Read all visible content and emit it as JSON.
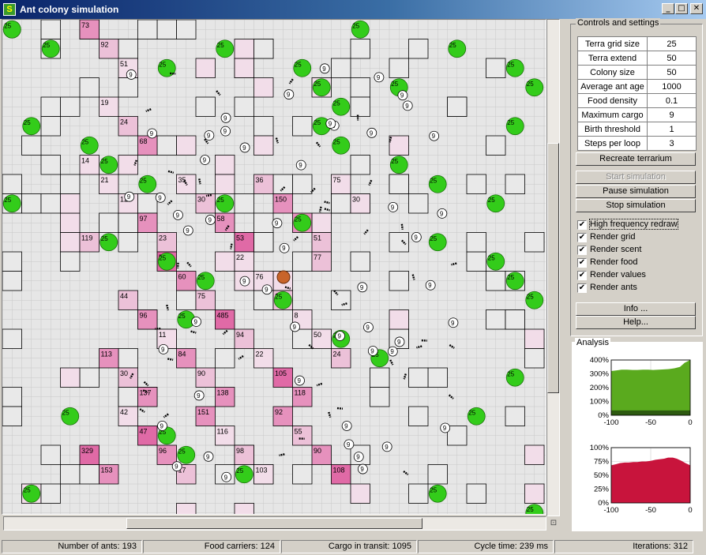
{
  "window": {
    "title": "Ant colony simulation",
    "app_icon": "S",
    "minimize_glyph": "_",
    "maximize_glyph": "□",
    "close_glyph": "✕"
  },
  "controls": {
    "group_title": "Controls and settings",
    "settings": [
      {
        "label": "Terra grid size",
        "value": "25"
      },
      {
        "label": "Terra extend",
        "value": "50"
      },
      {
        "label": "Colony size",
        "value": "50"
      },
      {
        "label": "Average ant age",
        "value": "1000"
      },
      {
        "label": "Food density",
        "value": "0.1"
      },
      {
        "label": "Maximum cargo",
        "value": "9"
      },
      {
        "label": "Birth threshold",
        "value": "1"
      },
      {
        "label": "Steps per loop",
        "value": "3"
      }
    ],
    "recreate_button": "Recreate terrarium",
    "start_button": "Start simulation",
    "pause_button": "Pause simulation",
    "stop_button": "Stop simulation",
    "checkboxes": [
      {
        "label": "High frequency redraw",
        "checked": true
      },
      {
        "label": "Render grid",
        "checked": true
      },
      {
        "label": "Render scent",
        "checked": true
      },
      {
        "label": "Render food",
        "checked": true
      },
      {
        "label": "Render values",
        "checked": true
      },
      {
        "label": "Render ants",
        "checked": true
      }
    ],
    "check_glyph": "✔",
    "info_button": "Info ...",
    "help_button": "Help..."
  },
  "status": {
    "ants": "Number of ants: 193",
    "carriers": "Food carriers: 124",
    "cargo": "Cargo in transit: 1095",
    "cycle": "Cycle time: 239 ms",
    "iterations": "Iterations: 312"
  },
  "terrarium": {
    "food_color": "#33cc1a",
    "food_value": "25",
    "nest_color": "#c8642a",
    "ant_marker": "9",
    "scent_colors": [
      "#f2dde9",
      "#ecc1d8",
      "#e691bd",
      "#e06aa6"
    ],
    "visited_color": "#d6d6d6",
    "food_cells": [
      [
        0,
        0
      ],
      [
        2,
        0
      ],
      [
        8,
        0
      ],
      [
        16,
        0
      ],
      [
        17,
        0
      ],
      [
        18,
        0
      ],
      [
        23,
        0
      ],
      [
        26,
        0
      ],
      [
        27,
        0
      ],
      [
        0,
        1
      ],
      [
        1,
        1
      ],
      [
        4,
        1
      ],
      [
        5,
        1
      ],
      [
        7,
        1
      ],
      [
        11,
        1
      ],
      [
        16,
        1
      ],
      [
        17,
        1
      ],
      [
        20,
        1
      ],
      [
        22,
        1
      ],
      [
        25,
        1
      ],
      [
        26,
        1
      ],
      [
        5,
        2
      ],
      [
        8,
        2
      ],
      [
        10,
        2
      ],
      [
        14,
        2
      ],
      [
        15,
        2
      ],
      [
        22,
        2
      ],
      [
        25,
        2
      ],
      [
        26,
        2
      ],
      [
        27,
        2
      ],
      [
        9,
        3
      ],
      [
        17,
        3
      ],
      [
        19,
        3
      ],
      [
        26,
        3
      ],
      [
        1,
        4
      ],
      [
        3,
        4
      ],
      [
        8,
        4
      ],
      [
        9,
        4
      ],
      [
        12,
        4
      ],
      [
        22,
        4
      ],
      [
        24,
        4
      ],
      [
        0,
        5
      ],
      [
        11,
        5
      ],
      [
        15,
        5
      ],
      [
        20,
        5
      ],
      [
        27,
        5
      ]
    ],
    "scent_cells": [
      [
        4,
        0,
        3,
        "73"
      ],
      [
        5,
        0,
        2,
        "92"
      ],
      [
        6,
        0,
        1,
        "51"
      ],
      [
        4,
        1,
        1,
        "14"
      ],
      [
        5,
        1,
        1,
        "19"
      ],
      [
        6,
        1,
        2,
        "24"
      ],
      [
        7,
        1,
        3,
        "68"
      ],
      [
        4,
        2,
        2,
        "119"
      ],
      [
        5,
        2,
        1,
        "21"
      ],
      [
        6,
        2,
        1,
        "12"
      ],
      [
        7,
        2,
        3,
        "97"
      ],
      [
        8,
        2,
        2,
        "23"
      ],
      [
        9,
        2,
        1,
        "35"
      ],
      [
        10,
        2,
        2,
        "30"
      ],
      [
        11,
        2,
        3,
        "58"
      ],
      [
        12,
        2,
        4,
        "53"
      ],
      [
        13,
        2,
        2,
        "36"
      ],
      [
        14,
        2,
        3,
        "150"
      ],
      [
        15,
        2,
        3,
        "44"
      ],
      [
        16,
        2,
        2,
        "51"
      ],
      [
        17,
        2,
        1,
        "75"
      ],
      [
        18,
        2,
        1,
        "30"
      ],
      [
        6,
        3,
        2,
        "44"
      ],
      [
        7,
        3,
        3,
        "96"
      ],
      [
        8,
        3,
        4,
        "579"
      ],
      [
        9,
        3,
        3,
        "60"
      ],
      [
        10,
        3,
        2,
        "75"
      ],
      [
        11,
        3,
        4,
        "485"
      ],
      [
        12,
        3,
        1,
        "22"
      ],
      [
        13,
        3,
        1,
        "76"
      ],
      [
        14,
        3,
        2,
        "17"
      ],
      [
        15,
        3,
        1,
        "8"
      ],
      [
        16,
        3,
        2,
        "77"
      ],
      [
        5,
        4,
        3,
        "113"
      ],
      [
        6,
        4,
        2,
        "30"
      ],
      [
        7,
        4,
        3,
        "137"
      ],
      [
        8,
        4,
        1,
        "11"
      ],
      [
        9,
        4,
        3,
        "84"
      ],
      [
        10,
        4,
        2,
        "90"
      ],
      [
        11,
        4,
        3,
        "138"
      ],
      [
        12,
        4,
        2,
        "94"
      ],
      [
        13,
        4,
        1,
        "22"
      ],
      [
        14,
        4,
        4,
        "105"
      ],
      [
        15,
        4,
        3,
        "118"
      ],
      [
        16,
        4,
        1,
        "50"
      ],
      [
        17,
        4,
        2,
        "24"
      ],
      [
        4,
        5,
        4,
        "329"
      ],
      [
        5,
        5,
        3,
        "153"
      ],
      [
        6,
        5,
        1,
        "42"
      ],
      [
        7,
        5,
        4,
        "47"
      ],
      [
        8,
        5,
        3,
        "96"
      ],
      [
        9,
        5,
        2,
        "17"
      ],
      [
        10,
        5,
        3,
        "151"
      ],
      [
        11,
        5,
        1,
        "116"
      ],
      [
        12,
        5,
        2,
        "98"
      ],
      [
        13,
        5,
        1,
        "103"
      ],
      [
        14,
        5,
        3,
        "92"
      ],
      [
        15,
        5,
        2,
        "55"
      ],
      [
        16,
        5,
        3,
        "90"
      ],
      [
        17,
        5,
        4,
        "108"
      ]
    ]
  },
  "analysis": {
    "group_title": "Analysis"
  },
  "chart_data": [
    {
      "type": "area",
      "series": [
        {
          "values": [
            320,
            325,
            330,
            330,
            328,
            328,
            330,
            330,
            328,
            330,
            332,
            334,
            340,
            350,
            380,
            400
          ]
        }
      ],
      "x": [
        -100,
        -93,
        -87,
        -80,
        -73,
        -67,
        -60,
        -53,
        -47,
        -40,
        -33,
        -27,
        -20,
        -13,
        -7,
        0
      ],
      "dark_base": 35,
      "ylim": [
        0,
        400
      ],
      "yticks": [
        "400%",
        "300%",
        "200%",
        "100%",
        "0%"
      ],
      "xticks": [
        "-100",
        "-50",
        "0"
      ],
      "fill_color": "#5aaa1e",
      "base_color": "#2d5a10",
      "grid": true
    },
    {
      "type": "area",
      "series": [
        {
          "values": [
            68,
            70,
            72,
            73,
            73,
            74,
            74,
            75,
            75,
            76,
            78,
            79,
            80,
            82,
            82,
            80,
            76,
            72,
            68
          ]
        }
      ],
      "x": [
        -100,
        -94,
        -89,
        -83,
        -78,
        -72,
        -67,
        -61,
        -56,
        -50,
        -44,
        -39,
        -33,
        -28,
        -22,
        -17,
        -11,
        -6,
        0
      ],
      "ylim": [
        0,
        100
      ],
      "yticks": [
        "100%",
        "75%",
        "50%",
        "25%",
        "0%"
      ],
      "xticks": [
        "-100",
        "-50",
        "0"
      ],
      "fill_color": "#c8143c",
      "grid": true
    }
  ]
}
